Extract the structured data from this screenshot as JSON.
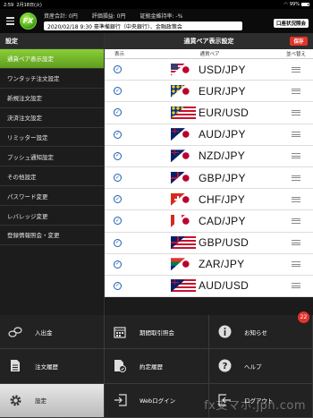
{
  "statusbar": {
    "time": "2:59",
    "date": "2月18日(火)",
    "battery": "99%"
  },
  "header": {
    "total_assets": "資産合計: 0円",
    "pl": "評価損益: 0円",
    "margin_ratio": "証拠金維持率: -%",
    "news": "2020/02/18 9:30 豪準備銀行（中央銀行）、金融政策会",
    "account_button": "口座状況照会"
  },
  "sidebar": {
    "title": "設定",
    "items": [
      {
        "label": "通貨ペア表示設定",
        "active": true
      },
      {
        "label": "ワンタッチ注文設定"
      },
      {
        "label": "新規注文設定"
      },
      {
        "label": "決済注文設定"
      },
      {
        "label": "リミッター設定"
      },
      {
        "label": "プッシュ通知設定"
      },
      {
        "label": "その他設定"
      },
      {
        "label": "パスワード変更"
      },
      {
        "label": "レバレッジ変更"
      },
      {
        "label": "登録情報照会・変更"
      }
    ]
  },
  "main": {
    "title": "通貨ペア表示設定",
    "save_label": "保存",
    "columns": {
      "show": "表示",
      "pair": "通貨ペア",
      "sort": "並べ替え"
    },
    "rows": [
      {
        "pair": "USD/JPY",
        "base": "us",
        "quote": "jp",
        "checked": true
      },
      {
        "pair": "EUR/JPY",
        "base": "eu",
        "quote": "jp",
        "checked": true
      },
      {
        "pair": "EUR/USD",
        "base": "eu",
        "quote": "us",
        "checked": true
      },
      {
        "pair": "AUD/JPY",
        "base": "au",
        "quote": "jp",
        "checked": true
      },
      {
        "pair": "NZD/JPY",
        "base": "nz",
        "quote": "jp",
        "checked": true
      },
      {
        "pair": "GBP/JPY",
        "base": "gb",
        "quote": "jp",
        "checked": true
      },
      {
        "pair": "CHF/JPY",
        "base": "ch",
        "quote": "jp",
        "checked": true
      },
      {
        "pair": "CAD/JPY",
        "base": "ca",
        "quote": "jp",
        "checked": true
      },
      {
        "pair": "GBP/USD",
        "base": "gb",
        "quote": "us",
        "checked": true
      },
      {
        "pair": "ZAR/JPY",
        "base": "za",
        "quote": "jp",
        "checked": true
      },
      {
        "pair": "AUD/USD",
        "base": "au",
        "quote": "us",
        "checked": true
      }
    ]
  },
  "menu": [
    {
      "label": "入出金",
      "icon": "deposit-icon"
    },
    {
      "label": "期間取引照会",
      "icon": "calendar-icon"
    },
    {
      "label": "お知らせ",
      "icon": "info-icon",
      "badge": "22"
    },
    {
      "label": "注文履歴",
      "icon": "order-history-icon"
    },
    {
      "label": "約定履歴",
      "icon": "execution-history-icon"
    },
    {
      "label": "ヘルプ",
      "icon": "help-icon"
    },
    {
      "label": "設定",
      "icon": "gear-icon",
      "active": true
    },
    {
      "label": "Webログイン",
      "icon": "web-login-icon"
    },
    {
      "label": "ログアウト",
      "icon": "logout-icon"
    }
  ],
  "watermark": "fx支マホ.jpn.com",
  "colors": {
    "accent_green": "#6fb52a",
    "save_red": "#e4342a",
    "check_blue": "#1e5eb0"
  }
}
